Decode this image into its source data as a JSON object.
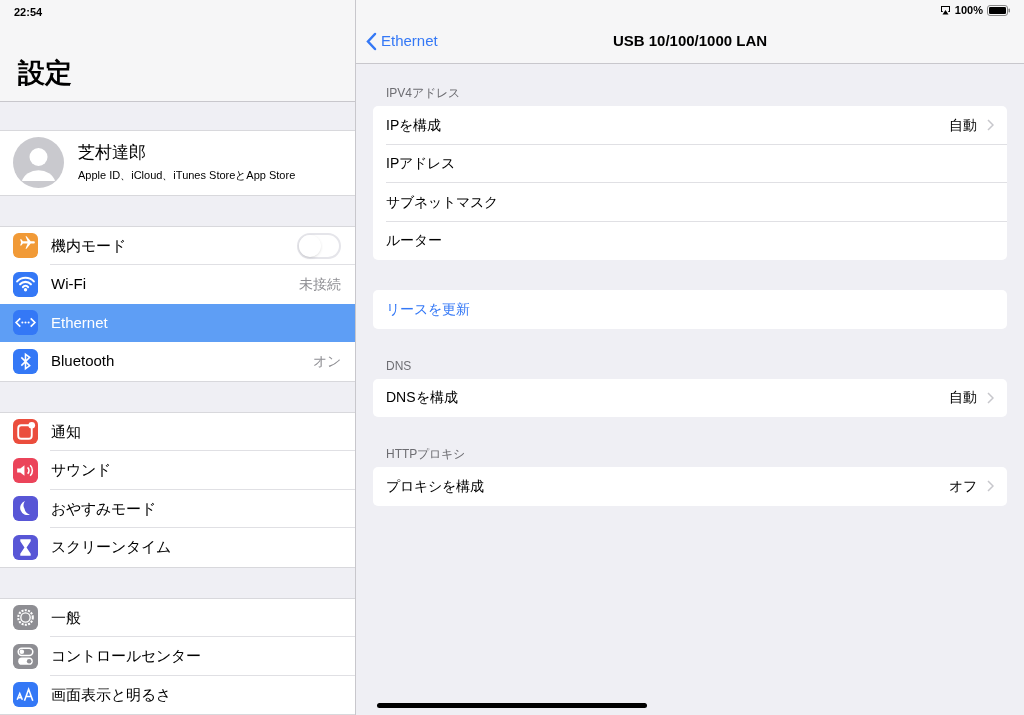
{
  "status_bar": {
    "time": "22:54",
    "battery": "100%"
  },
  "sidebar": {
    "title": "設定",
    "profile": {
      "name": "芝村達郎",
      "subtitle": "Apple ID、iCloud、iTunes StoreとApp Store"
    },
    "groups": [
      {
        "items": [
          {
            "kind": "toggle",
            "label": "機内モード",
            "on": false,
            "selected": false,
            "color": "#f19a37"
          },
          {
            "kind": "value",
            "label": "Wi-Fi",
            "value": "未接続",
            "selected": false,
            "color": "#3478f6"
          },
          {
            "kind": "plain",
            "label": "Ethernet",
            "selected": true,
            "color": "#3478f6"
          },
          {
            "kind": "value",
            "label": "Bluetooth",
            "value": "オン",
            "selected": false,
            "color": "#3478f6"
          }
        ]
      },
      {
        "items": [
          {
            "kind": "plain",
            "label": "通知",
            "selected": false,
            "color": "#eb4d3d"
          },
          {
            "kind": "plain",
            "label": "サウンド",
            "selected": false,
            "color": "#eb445a"
          },
          {
            "kind": "plain",
            "label": "おやすみモード",
            "selected": false,
            "color": "#5856d6"
          },
          {
            "kind": "plain",
            "label": "スクリーンタイム",
            "selected": false,
            "color": "#5856d6"
          }
        ]
      },
      {
        "items": [
          {
            "kind": "plain",
            "label": "一般",
            "selected": false,
            "color": "#8e8e93"
          },
          {
            "kind": "plain",
            "label": "コントロールセンター",
            "selected": false,
            "color": "#8e8e93"
          },
          {
            "kind": "plain",
            "label": "画面表示と明るさ",
            "selected": false,
            "color": "#3478f6"
          }
        ]
      }
    ]
  },
  "detail": {
    "back": "Ethernet",
    "title": "USB 10/100/1000 LAN",
    "sections": [
      {
        "header": "IPV4アドレス",
        "rows": [
          {
            "kind": "disclosure",
            "label": "IPを構成",
            "value": "自動"
          },
          {
            "kind": "plain",
            "label": "IPアドレス"
          },
          {
            "kind": "plain",
            "label": "サブネットマスク"
          },
          {
            "kind": "plain",
            "label": "ルーター"
          }
        ]
      },
      {
        "rows": [
          {
            "kind": "action",
            "label": "リースを更新"
          }
        ]
      },
      {
        "header": "DNS",
        "rows": [
          {
            "kind": "disclosure",
            "label": "DNSを構成",
            "value": "自動"
          }
        ]
      },
      {
        "header": "HTTPプロキシ",
        "rows": [
          {
            "kind": "disclosure",
            "label": "プロキシを構成",
            "value": "オフ"
          }
        ]
      }
    ]
  }
}
